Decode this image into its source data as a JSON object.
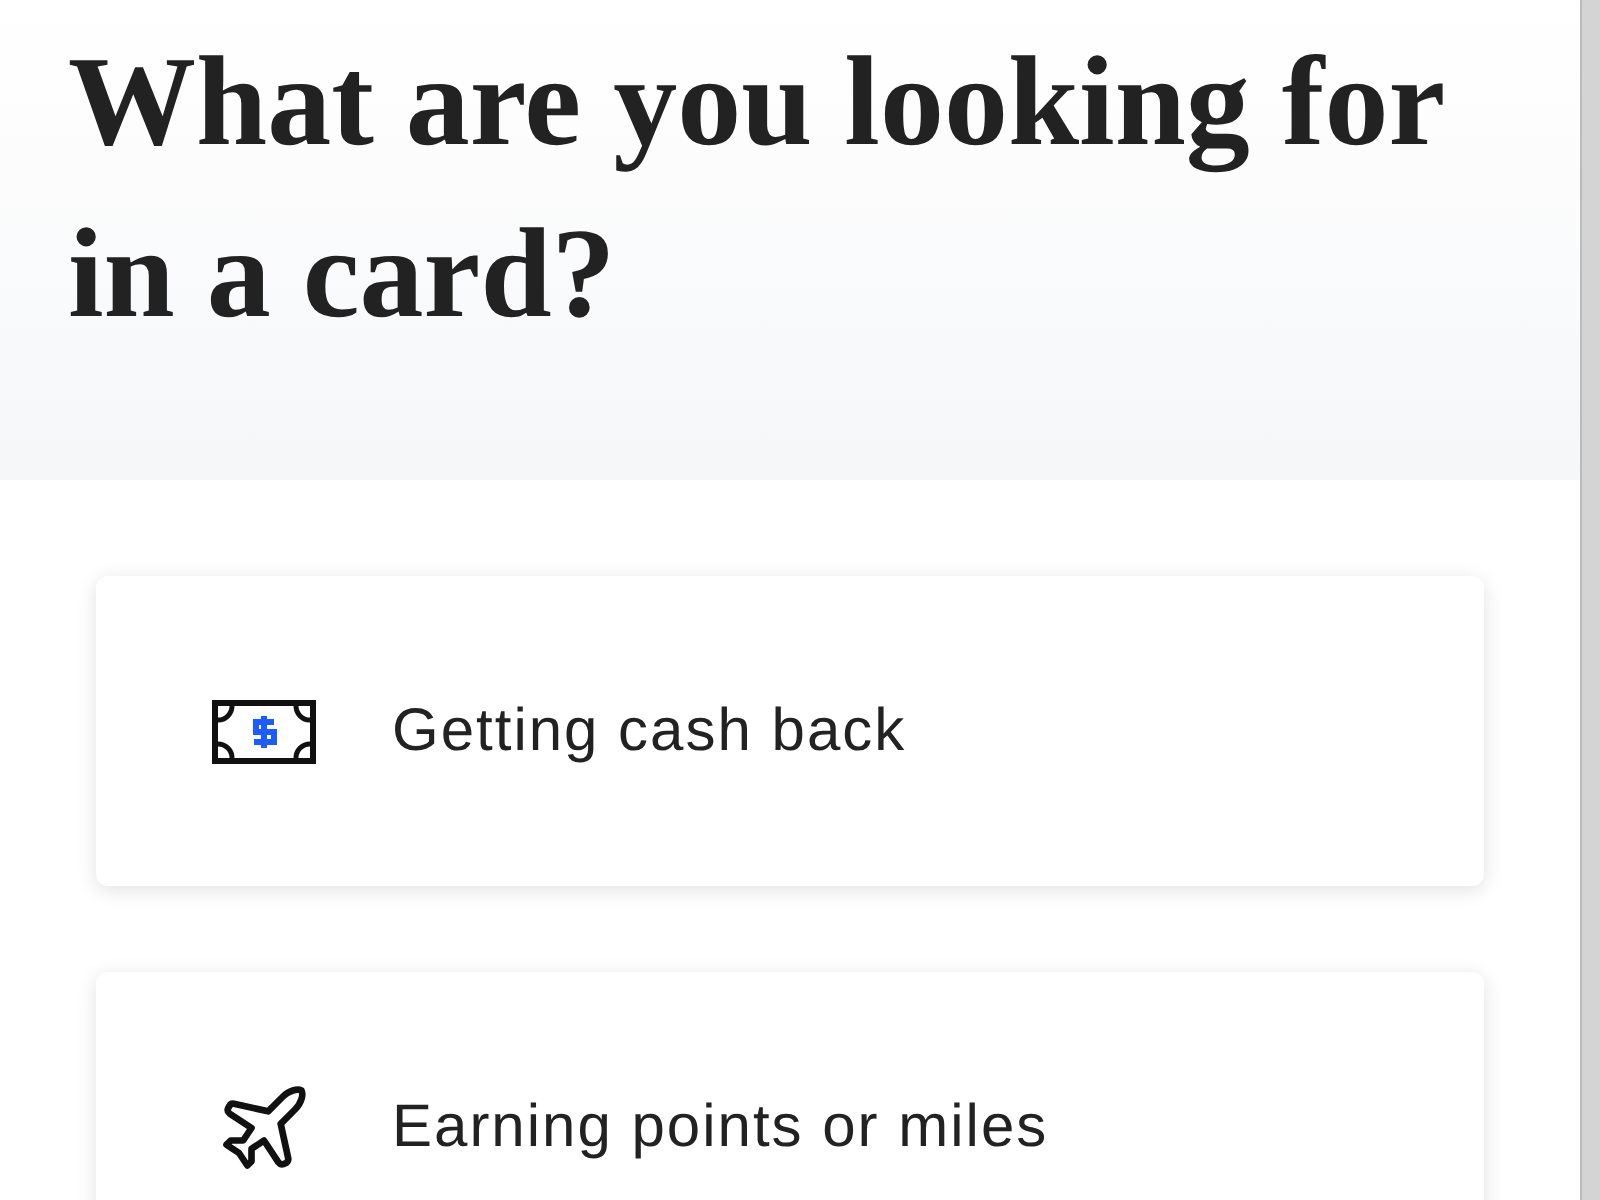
{
  "heading": "What are you looking for in a card?",
  "options": [
    {
      "kind": "cash",
      "label": "Getting cash back"
    },
    {
      "kind": "plane",
      "label": "Earning points or miles"
    }
  ]
}
